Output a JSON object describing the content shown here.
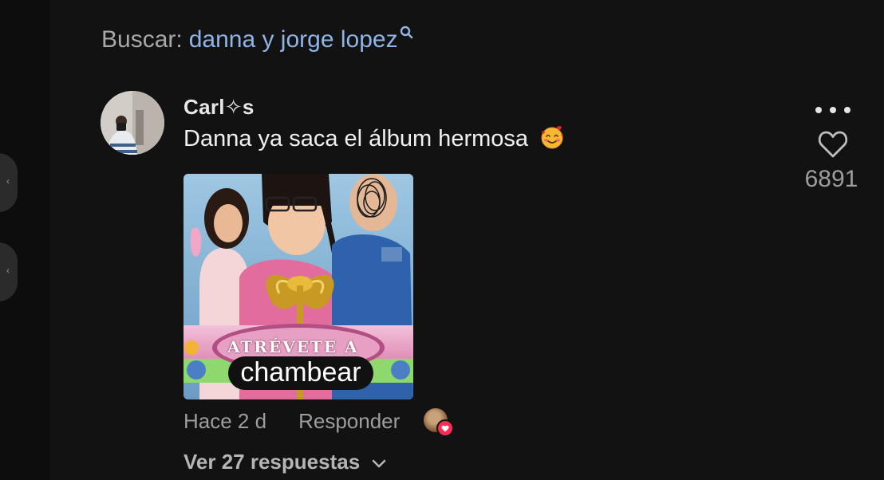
{
  "search": {
    "prefix": "Buscar:",
    "query": "danna y jorge lopez",
    "icon": "search-icon"
  },
  "comment": {
    "username": "Carl✧s",
    "text": "Danna ya saca el álbum hermosa",
    "emoji": "smiling-face-with-hearts-emoji",
    "image": {
      "banner": "ATRÉVETE A",
      "caption": "chambear"
    },
    "time": "Hace 2 d",
    "reply_label": "Responder",
    "likes": "6891",
    "view_replies": "Ver 27 respuestas"
  },
  "colors": {
    "background": "#121212",
    "query_link": "#8fb4e6",
    "heart_badge": "#fe2c55"
  }
}
